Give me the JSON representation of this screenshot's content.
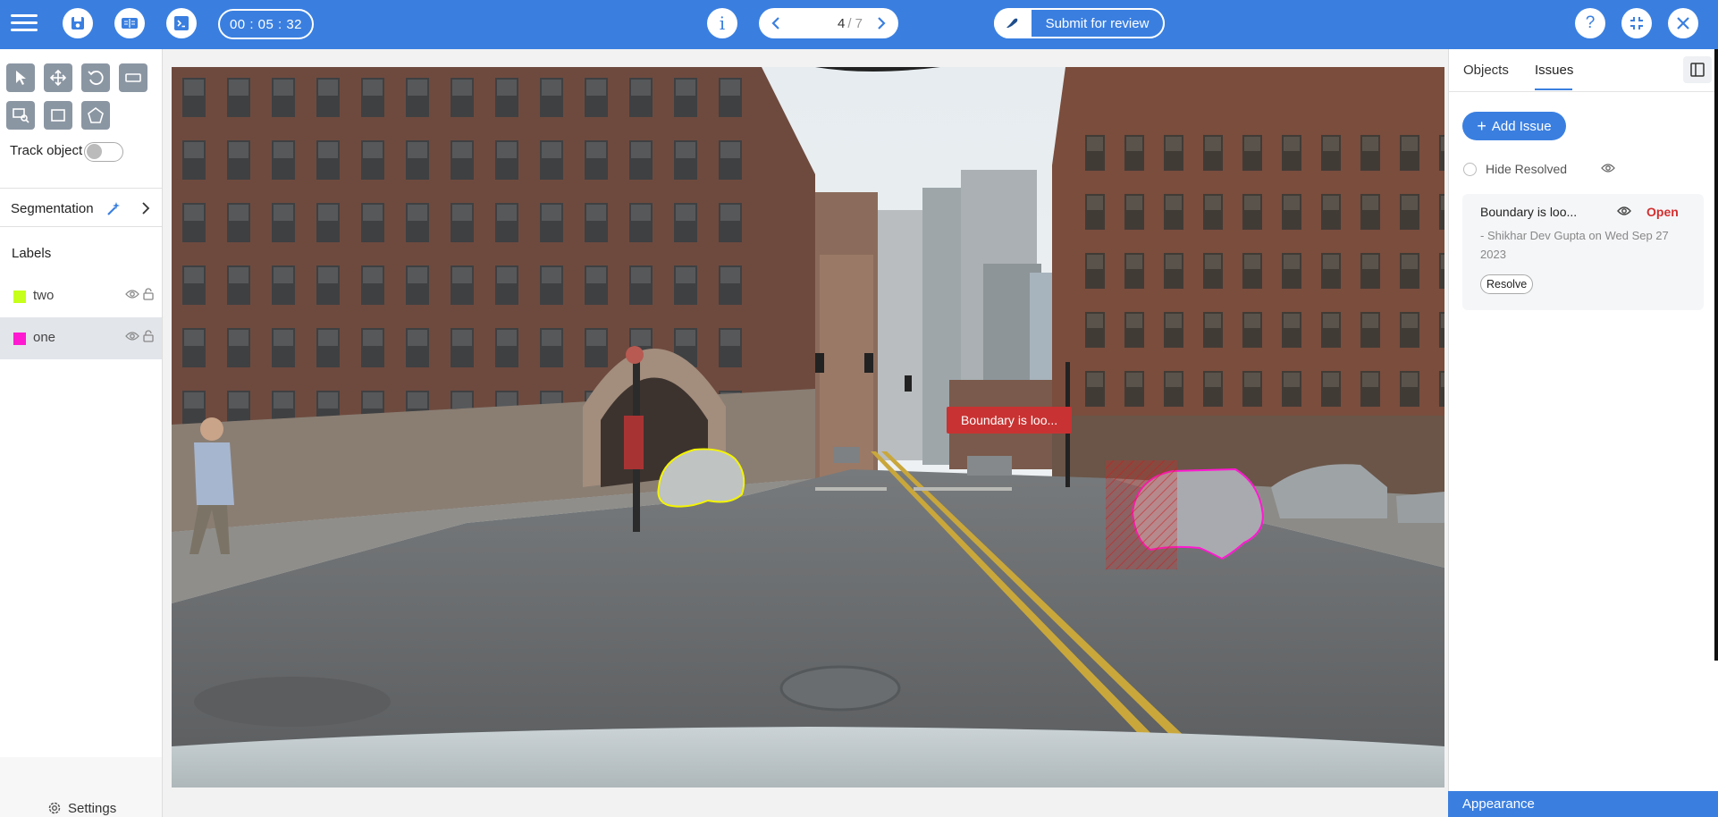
{
  "topbar": {
    "timer": "00 : 05 : 32",
    "page_current": "4",
    "page_total": "/ 7",
    "submit_label": "Submit for review",
    "icons": [
      "menu-icon",
      "save-icon",
      "book-icon",
      "terminal-icon",
      "info-icon",
      "chevron-left-icon",
      "chevron-right-icon",
      "brush-icon",
      "help-icon",
      "fullscreen-exit-icon",
      "close-icon"
    ],
    "accent": "#3a7fe0"
  },
  "left": {
    "track_label": "Track object",
    "track_on": false,
    "segmentation_label": "Segmentation",
    "labels_title": "Labels",
    "labels": [
      {
        "name": "two",
        "color": "#c6ff1a"
      },
      {
        "name": "one",
        "color": "#ff1ad1"
      }
    ],
    "settings_label": "Settings"
  },
  "canvas": {
    "issue_tag": "Boundary is loo..."
  },
  "right": {
    "tabs": [
      "Objects",
      "Issues"
    ],
    "active_tab": "Issues",
    "add_issue_label": "Add Issue",
    "hide_resolved_label": "Hide Resolved",
    "issue": {
      "title": "Boundary is loo...",
      "status": "Open",
      "meta": "- Shikhar Dev Gupta on Wed Sep 27 2023",
      "resolve_label": "Resolve"
    },
    "appearance_label": "Appearance"
  }
}
